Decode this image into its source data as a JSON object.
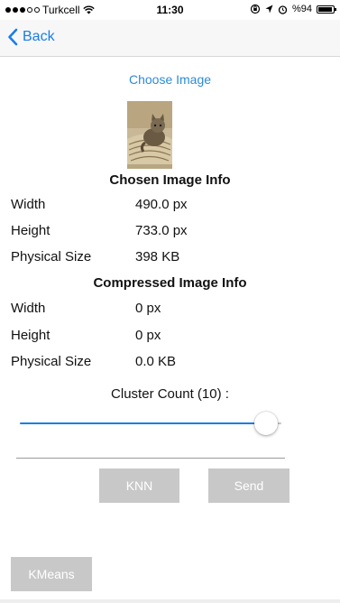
{
  "status_bar": {
    "carrier": "Turkcell",
    "time": "11:30",
    "battery_text": "%94",
    "battery_level_percent": 94
  },
  "nav": {
    "back_label": "Back"
  },
  "choose_image_label": "Choose Image",
  "chosen_info": {
    "title": "Chosen Image Info",
    "width_label": "Width",
    "width_value": "490.0 px",
    "height_label": "Height",
    "height_value": "733.0 px",
    "size_label": "Physical Size",
    "size_value": "398 KB"
  },
  "compressed_info": {
    "title": "Compressed Image Info",
    "width_label": "Width",
    "width_value": "0 px",
    "height_label": "Height",
    "height_value": "0 px",
    "size_label": "Physical Size",
    "size_value": "0.0 KB"
  },
  "cluster": {
    "label": "Cluster Count (10) :",
    "slider_fraction": 0.94
  },
  "buttons": {
    "knn_label": "KNN",
    "send_label": "Send",
    "kmeans_label": "KMeans"
  },
  "colors": {
    "accent": "#1a7ee6",
    "link": "#2d8bd6",
    "button_gray": "#c8c8c8"
  }
}
